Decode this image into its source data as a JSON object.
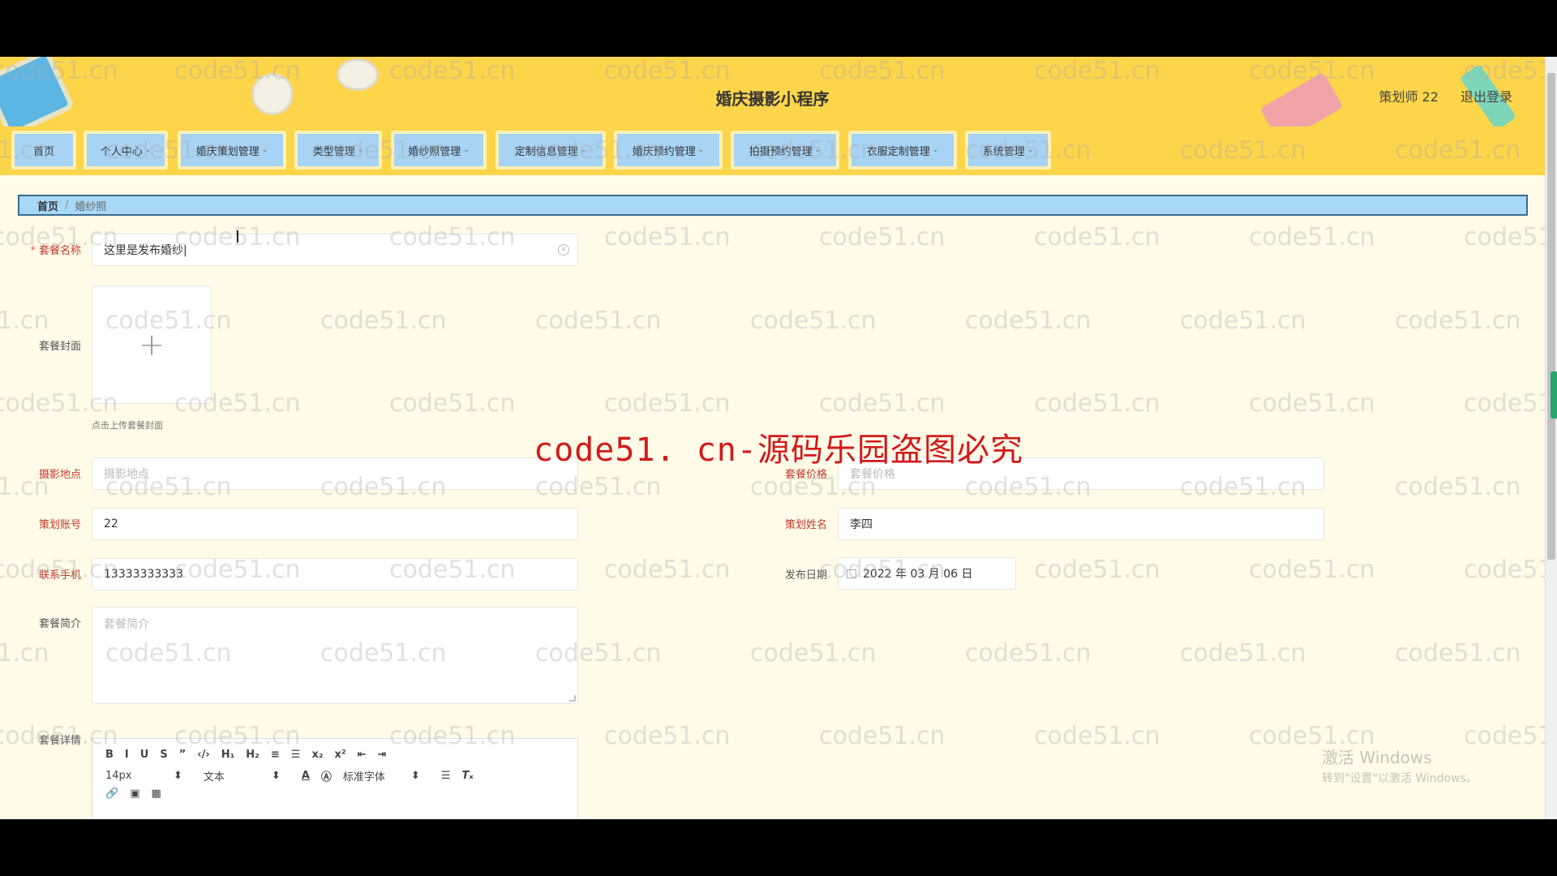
{
  "header": {
    "title": "婚庆摄影小程序",
    "user": "策划师 22",
    "logout": "退出登录"
  },
  "nav": {
    "items": [
      {
        "label": "首页",
        "dropdown": false
      },
      {
        "label": "个人中心",
        "dropdown": true
      },
      {
        "label": "婚庆策划管理",
        "dropdown": true
      },
      {
        "label": "类型管理",
        "dropdown": true
      },
      {
        "label": "婚纱照管理",
        "dropdown": true
      },
      {
        "label": "定制信息管理",
        "dropdown": true
      },
      {
        "label": "婚庆预约管理",
        "dropdown": true
      },
      {
        "label": "拍摄预约管理",
        "dropdown": true
      },
      {
        "label": "衣服定制管理",
        "dropdown": true
      },
      {
        "label": "系统管理",
        "dropdown": true
      }
    ]
  },
  "breadcrumb": {
    "home": "首页",
    "separator": "/",
    "current": "婚纱照"
  },
  "form": {
    "package_name": {
      "label": "套餐名称",
      "required": true,
      "value": "这里是发布婚纱|"
    },
    "cover": {
      "label": "套餐封面",
      "hint": "点击上传套餐封面",
      "plus": "+"
    },
    "location": {
      "label": "摄影地点",
      "placeholder": "摄影地点"
    },
    "price": {
      "label": "套餐价格",
      "placeholder": "套餐价格"
    },
    "planner_account": {
      "label": "策划账号",
      "value": "22"
    },
    "planner_name": {
      "label": "策划姓名",
      "value": "李四"
    },
    "phone": {
      "label": "联系手机",
      "value": "13333333333"
    },
    "publish_date": {
      "label": "发布日期",
      "value": "2022 年 03 月 06 日"
    },
    "intro": {
      "label": "套餐简介",
      "placeholder": "套餐简介"
    },
    "detail": {
      "label": "套餐详情"
    }
  },
  "editor_toolbar": {
    "row1": [
      "B",
      "I",
      "U",
      "S",
      "”",
      "‹/›",
      "H₁",
      "H₂",
      "≡",
      "☰",
      "x₂",
      "x²",
      "⇤",
      "⇥"
    ],
    "font_size": "14px",
    "text_type": "文本",
    "font_family": "标准字体",
    "color_a": "A",
    "row3": [
      "🔗",
      "▣",
      "▦"
    ]
  },
  "watermark": {
    "text": "code51.cn",
    "banner": "code51. cn-源码乐园盗图必究"
  },
  "os_notice": {
    "title": "激活 Windows",
    "subtitle": "转到\"设置\"以激活 Windows。"
  },
  "colors": {
    "header_bg": "#fcd54a",
    "nav_item_bg": "#a7d3f5",
    "breadcrumb_bg": "#a8d8f7",
    "page_bg": "#fffbe8",
    "required_label": "#c0392b",
    "banner_text": "#d11a1a"
  }
}
